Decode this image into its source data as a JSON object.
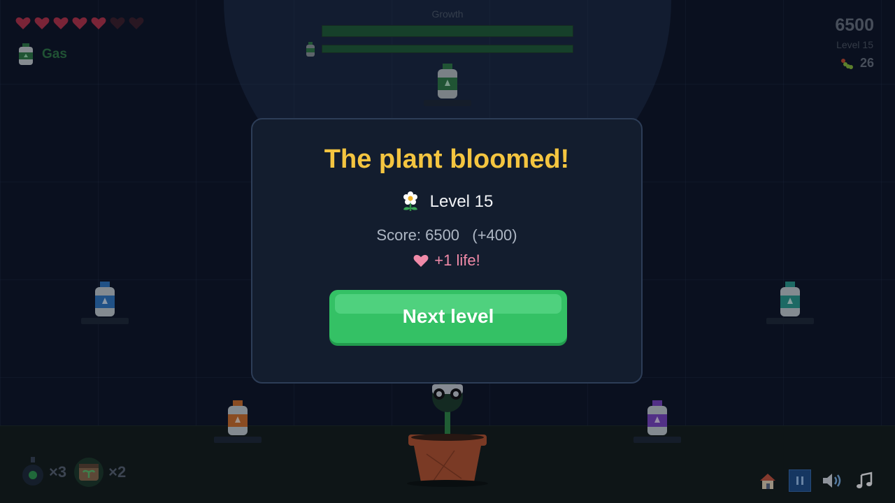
{
  "hud": {
    "lives_total": 7,
    "lives_filled": 5,
    "current_tool": "Gas",
    "growth_label": "Growth",
    "growth_progress": 1.0,
    "secondary_progress": 1.0,
    "score": "6500",
    "level": "Level 15",
    "worms_count": "26"
  },
  "modal": {
    "title": "The plant bloomed!",
    "level_text": "Level 15",
    "score_text": "Score: 6500   (+400)",
    "life_text": "+1 life!",
    "next_button": "Next level"
  },
  "inventory": {
    "bomb_count": "×3",
    "seed_count": "×2"
  },
  "colors": {
    "accent_title": "#f4c540",
    "button_green": "#34c165",
    "heart": "#b8344a",
    "heart_empty": "#3d1f2a",
    "life_pink": "#f08aa8"
  },
  "bottles": [
    {
      "name": "top-green-bottle",
      "color": "#2e7d46"
    },
    {
      "name": "left-blue-bottle",
      "color": "#2f79c4"
    },
    {
      "name": "right-teal-bottle",
      "color": "#2a9d8f"
    },
    {
      "name": "bottom-left-orange-bottle",
      "color": "#d2702a"
    },
    {
      "name": "bottom-right-purple-bottle",
      "color": "#7b45c4"
    }
  ]
}
